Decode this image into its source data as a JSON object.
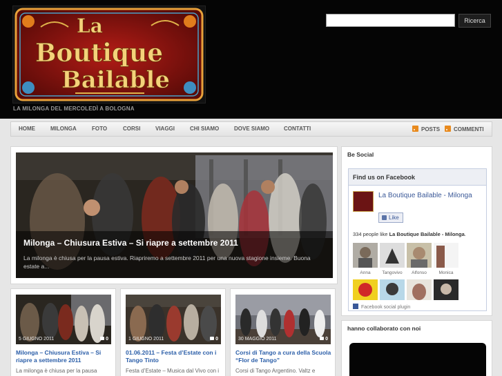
{
  "header": {
    "logo_text": [
      "La",
      "Boutique",
      "Bailable"
    ],
    "tagline": "LA MILONGA DEL MERCOLEDÌ A BOLOGNA",
    "search_placeholder": "",
    "search_button": "Ricerca"
  },
  "nav": {
    "items": [
      "HOME",
      "MILONGA",
      "FOTO",
      "CORSI",
      "VIAGGI",
      "CHI SIAMO",
      "DOVE SIAMO",
      "CONTATTI"
    ],
    "feeds": [
      "POSTS",
      "COMMENTI"
    ]
  },
  "featured": {
    "title": "Milonga – Chiusura Estiva – Si riapre a settembre 2011",
    "excerpt": "La milonga è chiusa per la pausa estiva. Riapriremo a settembre 2011 per una nuova stagione insieme. Buona estate a..."
  },
  "posts": [
    {
      "date": "5 GIUGNO 2011",
      "comments": "0",
      "title": "Milonga – Chiusura Estiva – Si riapre a settembre 2011",
      "excerpt": "La milonga è chiusa per la pausa"
    },
    {
      "date": "1 GIUGNO 2011",
      "comments": "0",
      "title": "01.06.2011 – Festa d’Estate con i Tango Tinto",
      "excerpt": "Festa d’Estate – Musica dal Vivo con i"
    },
    {
      "date": "30 MAGGIO 2011",
      "comments": "0",
      "title": "Corsi di Tango a cura della Scuola “Flor de Tango”",
      "excerpt": "Corsi di Tango Argentino. Valtz e"
    }
  ],
  "sidebar": {
    "social_title": "Be Social",
    "facebook": {
      "header": "Find us on Facebook",
      "page_name": "La Boutique Bailable - Milonga",
      "like_label": "Like",
      "count_text": "334 people like",
      "count_page": "La Boutique Bailable - Milonga",
      "fans": [
        "Anna",
        "Tangovivo",
        "Alfonso",
        "Monica",
        "",
        "",
        "",
        ""
      ],
      "plugin_label": "Facebook social plugin"
    },
    "collab_title": "hanno collaborato con noi"
  },
  "colors": {
    "link": "#2b5ea8",
    "facebook": "#3b5998",
    "header_bg": "#050505",
    "rss": "#e88a1e"
  }
}
